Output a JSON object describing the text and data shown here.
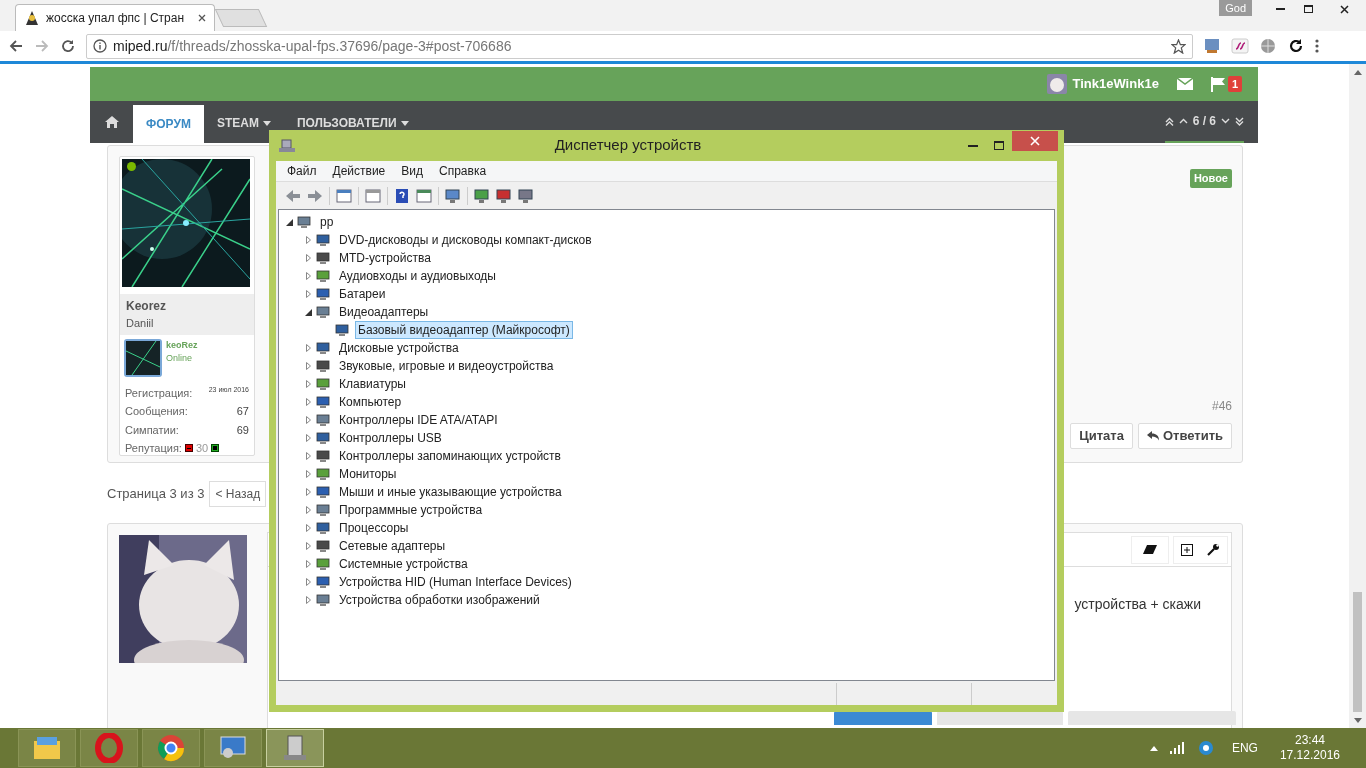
{
  "browser": {
    "tab_title": "жосска упал фпс | Стран",
    "profile": "God",
    "address_host": "miped.ru",
    "address_path": "/f/threads/zhosska-upal-fps.37696/page-3#post-706686"
  },
  "forum": {
    "username": "Tink1eWink1e",
    "alerts": "1",
    "nav": [
      {
        "label": "ФОРУМ",
        "selected": true,
        "dropdown": false
      },
      {
        "label": "STEAM",
        "selected": false,
        "dropdown": true
      },
      {
        "label": "ПОЛЬЗОВАТЕЛИ",
        "selected": false,
        "dropdown": true
      }
    ],
    "page_counter": "6 / 6",
    "post": {
      "author": "Keorez",
      "author_title": "Daniil",
      "online": true,
      "mini_name": "keoRez",
      "mini_status": "Online",
      "stats": [
        {
          "label": "Регистрация:",
          "value": "23 июл 2016",
          "kind": "date"
        },
        {
          "label": "Сообщения:",
          "value": "67",
          "kind": "number"
        },
        {
          "label": "Симпатии:",
          "value": "69",
          "kind": "number"
        }
      ],
      "reputation_label": "Репутация:",
      "reputation": "30",
      "badge": "Новое",
      "number": "#46",
      "quote_button": "Цитата",
      "reply_button": "Ответить"
    },
    "pagination": {
      "label": "Страница 3 из 3",
      "prev": "< Назад"
    },
    "reply": {
      "text": "устройства + скажи"
    }
  },
  "device_manager": {
    "title": "Диспетчер устройств",
    "menu": [
      "Файл",
      "Действие",
      "Вид",
      "Справка"
    ],
    "tree": {
      "label": "pp",
      "expanded": true,
      "selected": false,
      "children": [
        {
          "label": "DVD-дисководы и дисководы компакт-дисков",
          "expanded": false,
          "selected": false
        },
        {
          "label": "MTD-устройства",
          "expanded": false,
          "selected": false
        },
        {
          "label": "Аудиовходы и аудиовыходы",
          "expanded": false,
          "selected": false
        },
        {
          "label": "Батареи",
          "expanded": false,
          "selected": false
        },
        {
          "label": "Видеоадаптеры",
          "expanded": true,
          "selected": false,
          "children": [
            {
              "label": "Базовый видеоадаптер (Майкрософт)",
              "selected": true
            }
          ]
        },
        {
          "label": "Дисковые устройства",
          "expanded": false,
          "selected": false
        },
        {
          "label": "Звуковые, игровые и видеоустройства",
          "expanded": false,
          "selected": false
        },
        {
          "label": "Клавиатуры",
          "expanded": false,
          "selected": false
        },
        {
          "label": "Компьютер",
          "expanded": false,
          "selected": false
        },
        {
          "label": "Контроллеры IDE ATA/ATAPI",
          "expanded": false,
          "selected": false
        },
        {
          "label": "Контроллеры USB",
          "expanded": false,
          "selected": false
        },
        {
          "label": "Контроллеры запоминающих устройств",
          "expanded": false,
          "selected": false
        },
        {
          "label": "Мониторы",
          "expanded": false,
          "selected": false
        },
        {
          "label": "Мыши и иные указывающие устройства",
          "expanded": false,
          "selected": false
        },
        {
          "label": "Программные устройства",
          "expanded": false,
          "selected": false
        },
        {
          "label": "Процессоры",
          "expanded": false,
          "selected": false
        },
        {
          "label": "Сетевые адаптеры",
          "expanded": false,
          "selected": false
        },
        {
          "label": "Системные устройства",
          "expanded": false,
          "selected": false
        },
        {
          "label": "Устройства HID (Human Interface Devices)",
          "expanded": false,
          "selected": false
        },
        {
          "label": "Устройства обработки изображений",
          "expanded": false,
          "selected": false
        }
      ]
    }
  },
  "taskbar": {
    "apps": [
      {
        "selected": false
      },
      {
        "selected": false
      },
      {
        "selected": false
      },
      {
        "selected": false
      },
      {
        "selected": true
      }
    ],
    "language": "ENG",
    "time": "23:44",
    "date": "17.12.2016"
  }
}
